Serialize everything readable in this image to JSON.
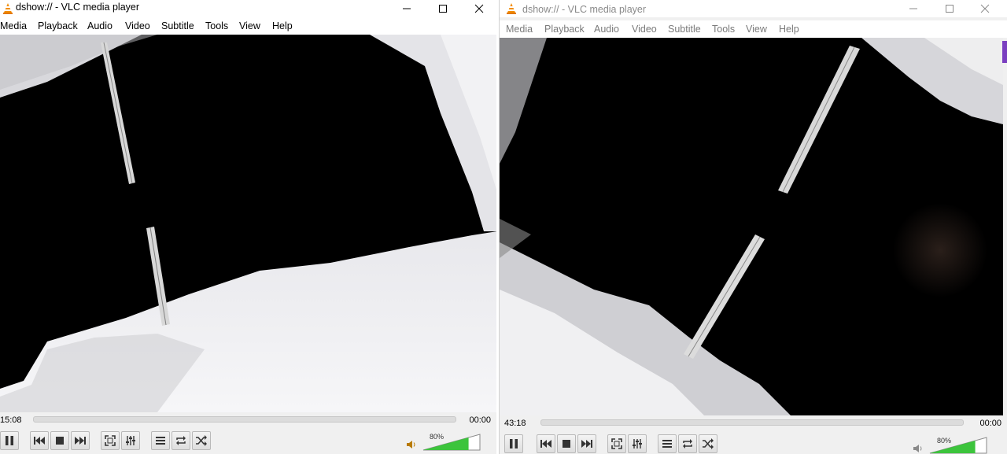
{
  "windows": [
    {
      "id": "left",
      "title": "dshow:// - VLC media player",
      "active": true,
      "menu": [
        "Media",
        "Playback",
        "Audio",
        "Video",
        "Subtitle",
        "Tools",
        "View",
        "Help"
      ],
      "elapsed": "15:08",
      "remaining": "00:00",
      "volume": "80%",
      "volume_level": 0.8
    },
    {
      "id": "right",
      "title": "dshow:// - VLC media player",
      "active": false,
      "menu": [
        "Media",
        "Playback",
        "Audio",
        "Video",
        "Subtitle",
        "Tools",
        "View",
        "Help"
      ],
      "elapsed": "43:18",
      "remaining": "00:00",
      "volume": "80%",
      "volume_level": 0.8
    }
  ],
  "controls": [
    "pause-icon",
    "previous-icon",
    "stop-icon",
    "next-icon",
    "fullscreen-icon",
    "extended-settings-icon",
    "playlist-icon",
    "loop-icon",
    "shuffle-icon"
  ],
  "colors": {
    "vlc_orange": "#f28c00",
    "volume_green": "#3cc43c",
    "video_black": "#000000"
  }
}
